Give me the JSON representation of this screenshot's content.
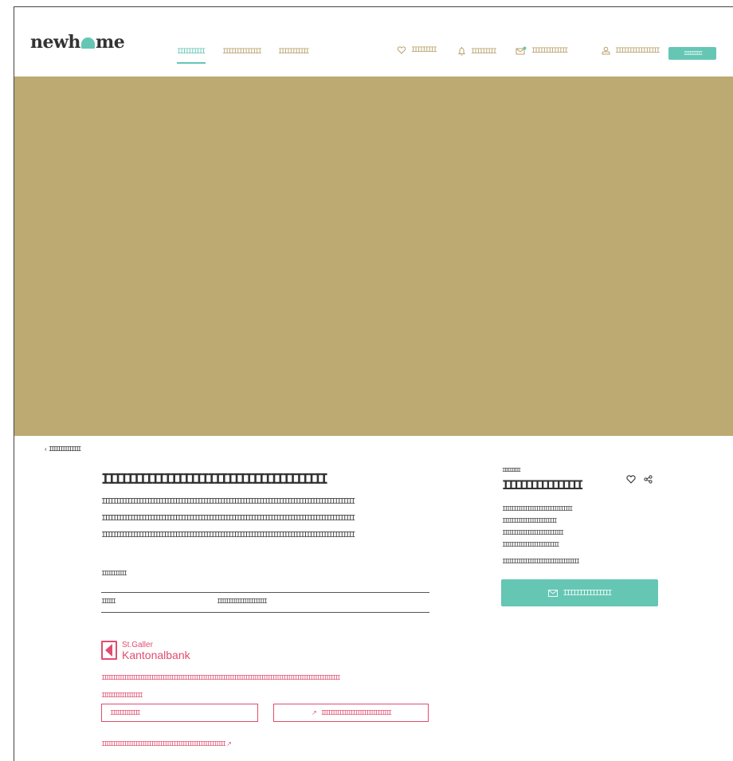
{
  "brand": {
    "logo_left": "newh",
    "logo_right": "me"
  },
  "nav": {
    "items": [
      {
        "label": "IIIIIIIIII"
      },
      {
        "label": "IIIIIIIIIIIIII"
      },
      {
        "label": "IIIIIIIIIII"
      }
    ]
  },
  "utility": {
    "favorites": "IIIIIIIII",
    "alerts": "IIIIIIIII",
    "messages": "IIIIIIIIIIIII",
    "account": "IIIIIIIIIIIIIIII",
    "login": "IIIIIIIIII"
  },
  "colors": {
    "accent": "#65c6b4",
    "gold": "#bdaa72",
    "bank": "#e04d70"
  },
  "back": {
    "label": "IIIIIIIIIIIIII"
  },
  "listing": {
    "title": "IIIIIIIIIIIIIIIIIIIIIIIIIIIIIIIIIIII",
    "description": [
      "IIIIIIIIIIIIIIIIIIIIIIIIIIIIIIIIIIIIIIIIIIIIIIIIIIIIIIIIIIIIIIIIIIIIIIIIIIIIIIIIIIIIIIIIII",
      "IIIIIIIIIIIIIIIIIIIIIIIIIIIIIIIIIIIIIIIIIIIIIIIIIIIIIIIIIIIIIIIIIIIIIIIIIIIIIIIIIIIIIIIIII",
      "IIIIIIIIIIIIIIIIIIIIIIIIIIIIIIIIIIIIIIIIIIIIIIIIIIIIIIIIIIIIIIIIIIIIIIIIIIIIIIIIIIIIIIIIII"
    ],
    "section_label": "IIIIIIIIIII",
    "row_key": "IIIIII",
    "row_value": "IIIIIIIIIIIIIIIIIIIIII"
  },
  "bank": {
    "name_line1": "St.Galler",
    "name_line2": "Kantonalbank",
    "text1": "IIIIIIIIIIIIIIIIIIIIIIIIIIIIIIIIIIIIIIIIIIIIIIIIIIIIIIIIIIIIIIIIIIIIIIIIIIIIIIIIIIIIIIIIIIIIIIIIIIIIIIIIII",
    "text2": "IIIIIIIIIIIIIIIIII",
    "button1": "IIIIIIIIIIIII",
    "button2": "IIIIIIIIIIIIIIIIIIIIIIIIIIIIIII",
    "link": "IIIIIIIIIIIIIIIIIIIIIIIIIIIIIIIIIIIIIIIIIIIIIIIIIIIIIII"
  },
  "side": {
    "kicker": "IIIIIIIIII",
    "title": "IIIIIIIIIIIIIII",
    "lines": [
      "IIIIIIIIIIIIIIIIIIIIIIIIIIIIIII",
      "IIIIIIIIIIIIIIIIIIIIIIII",
      "IIIIIIIIIIIIIIIIIIIIIIIIIII",
      "IIIIIIIIIIIIIIIIIIIIIIIII",
      "IIIIIIIIIIIIIIIIIIIIIIIIIIIIIIIIII"
    ],
    "contact_label": "IIIIIIIIIIIIIII"
  }
}
